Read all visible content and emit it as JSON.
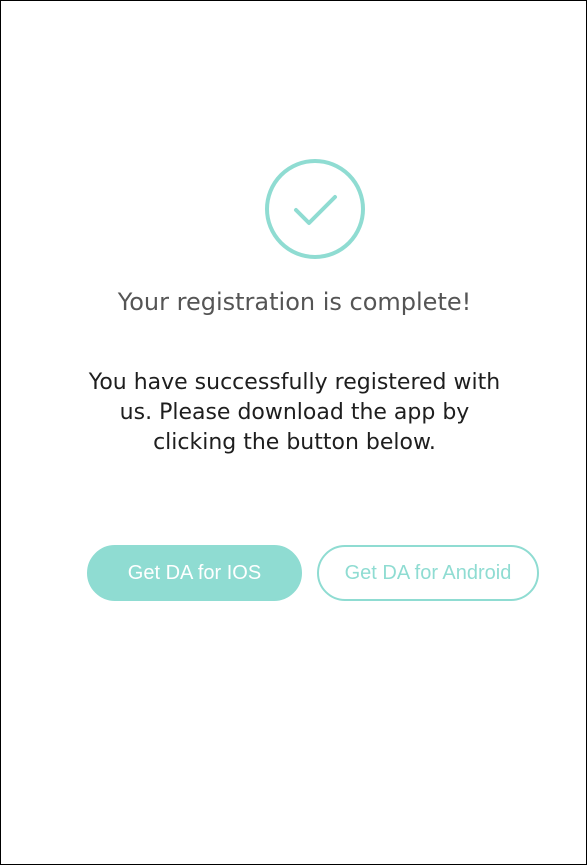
{
  "success": {
    "icon": "check-circle-icon",
    "title": "Your registration is complete!",
    "message": "You have successfully registered with us. Please download the app by clicking the button below."
  },
  "buttons": {
    "ios_label": "Get DA for IOS",
    "android_label": "Get DA for Android"
  },
  "colors": {
    "accent": "#8fdcd2",
    "title_text": "#555555",
    "body_text": "#1e1e1e"
  }
}
